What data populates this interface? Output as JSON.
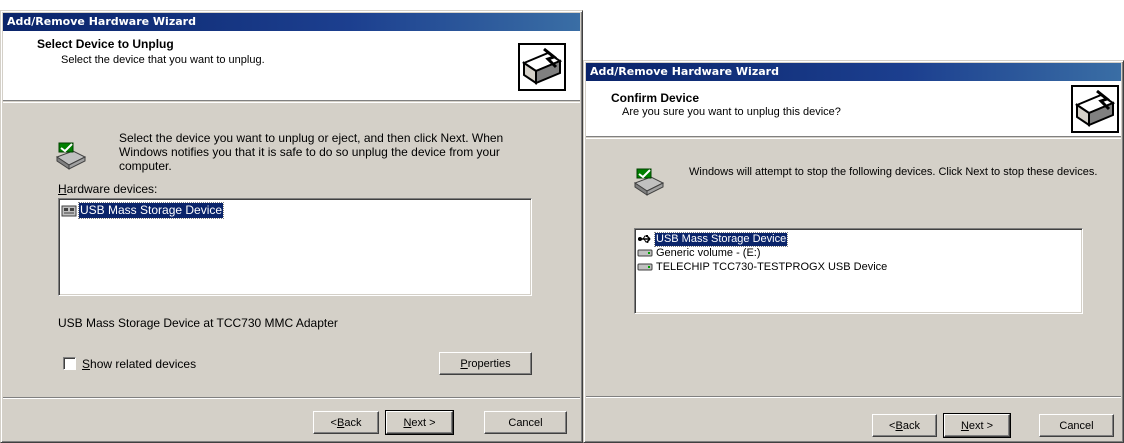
{
  "dialog1": {
    "title": "Add/Remove Hardware Wizard",
    "header_title": "Select Device to Unplug",
    "header_subtitle": "Select the device that you want to unplug.",
    "message": "Select the device you want to unplug or eject, and then click Next. When Windows notifies you that it is safe to do so unplug the device from your computer.",
    "list_label": "Hardware devices:",
    "list_items": [
      {
        "label": "USB Mass Storage Device",
        "icon": "usb-storage-icon",
        "selected": true
      }
    ],
    "device_description": "USB Mass Storage Device at TCC730 MMC Adapter",
    "checkbox_label": "Show related devices",
    "checkbox_checked": false,
    "properties_button": "Properties",
    "back_button": "< Back",
    "next_button": "Next >",
    "cancel_button": "Cancel"
  },
  "dialog2": {
    "title": "Add/Remove Hardware Wizard",
    "header_title": "Confirm Device",
    "header_subtitle": "Are you sure you want to unplug this device?",
    "message": "Windows will attempt to stop the following devices.  Click Next to stop these devices.",
    "list_items": [
      {
        "label": "USB Mass Storage Device",
        "icon": "usb-icon",
        "selected": true
      },
      {
        "label": "Generic volume - (E:)",
        "icon": "drive-icon",
        "selected": false
      },
      {
        "label": "TELECHIP TCC730-TESTPROGX USB Device",
        "icon": "drive-icon",
        "selected": false
      }
    ],
    "back_button": "< Back",
    "next_button": "Next >",
    "cancel_button": "Cancel"
  },
  "colors": {
    "title_bar": "#0a246a",
    "face": "#d4d0c8",
    "selection": "#0a246a"
  }
}
